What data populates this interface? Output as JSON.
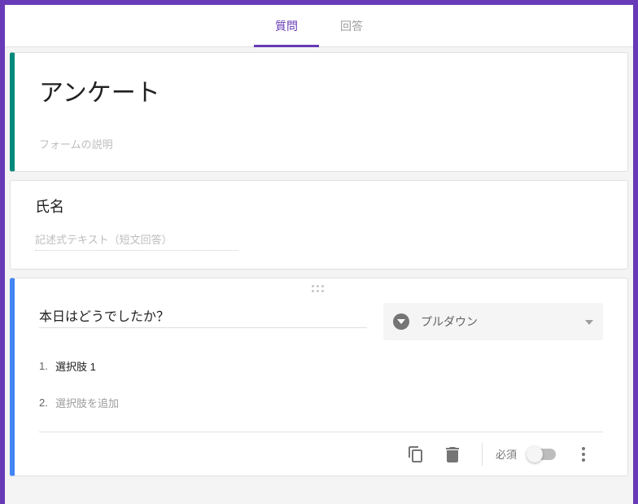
{
  "tabs": {
    "questions": "質問",
    "responses": "回答"
  },
  "form": {
    "title": "アンケート",
    "description_placeholder": "フォームの説明"
  },
  "q1": {
    "title": "氏名",
    "short_answer_placeholder": "記述式テキスト（短文回答）"
  },
  "q2": {
    "title": "本日はどうでしたか？",
    "type_label": "プルダウン",
    "options": {
      "num1": "1.",
      "opt1": "選択肢 1",
      "num2": "2.",
      "add": "選択肢を追加"
    }
  },
  "footer": {
    "required_label": "必須"
  }
}
